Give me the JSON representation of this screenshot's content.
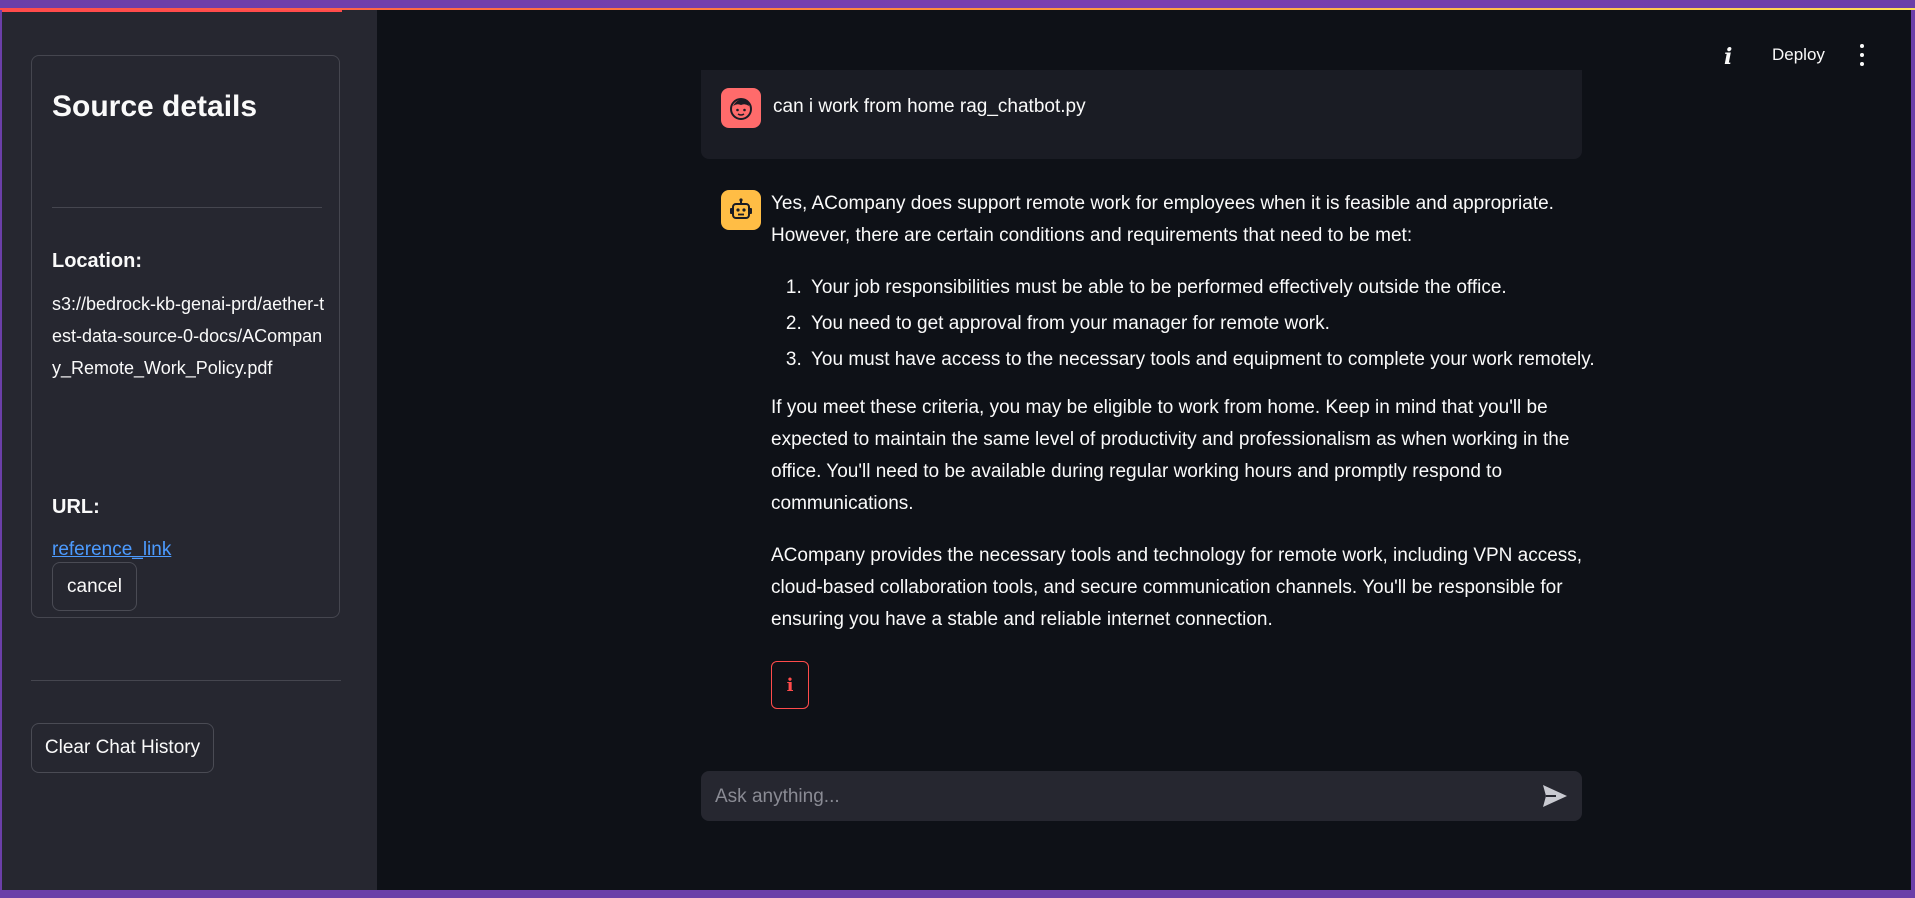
{
  "sidebar": {
    "source_title": "Source details",
    "location_label": "Location:",
    "location_value": "s3://bedrock-kb-genai-prd/aether-test-data-source-0-docs/ACompany_Remote_Work_Policy.pdf",
    "url_label": "URL:",
    "url_link": "reference_link",
    "cancel_label": "cancel",
    "clear_label": "Clear Chat History"
  },
  "header": {
    "deploy_label": "Deploy",
    "info_icon": "i"
  },
  "chat": {
    "user_message": "can i work from home rag_chatbot.py",
    "bot_intro": "Yes, ACompany does support remote work for employees when it is feasible and appropriate. However, there are certain conditions and requirements that need to be met:",
    "bot_list": [
      "Your job responsibilities must be able to be performed effectively outside the office.",
      "You need to get approval from your manager for remote work.",
      "You must have access to the necessary tools and equipment to complete your work remotely."
    ],
    "bot_para2": "If you meet these criteria, you may be eligible to work from home. Keep in mind that you'll be expected to maintain the same level of productivity and professionalism as when working in the office. You'll need to be available during regular working hours and promptly respond to communications.",
    "bot_para3": "ACompany provides the necessary tools and technology for remote work, including VPN access, cloud-based collaboration tools, and secure communication channels. You'll be responsible for ensuring you have a stable and reliable internet connection.",
    "info_button_label": "i",
    "input_placeholder": "Ask anything..."
  },
  "colors": {
    "background": "#0e1117",
    "sidebar": "#262730",
    "accent": "#ff4b4b",
    "link": "#4c9bff",
    "user_avatar": "#ff6b6b",
    "bot_avatar": "#ffbd45"
  }
}
